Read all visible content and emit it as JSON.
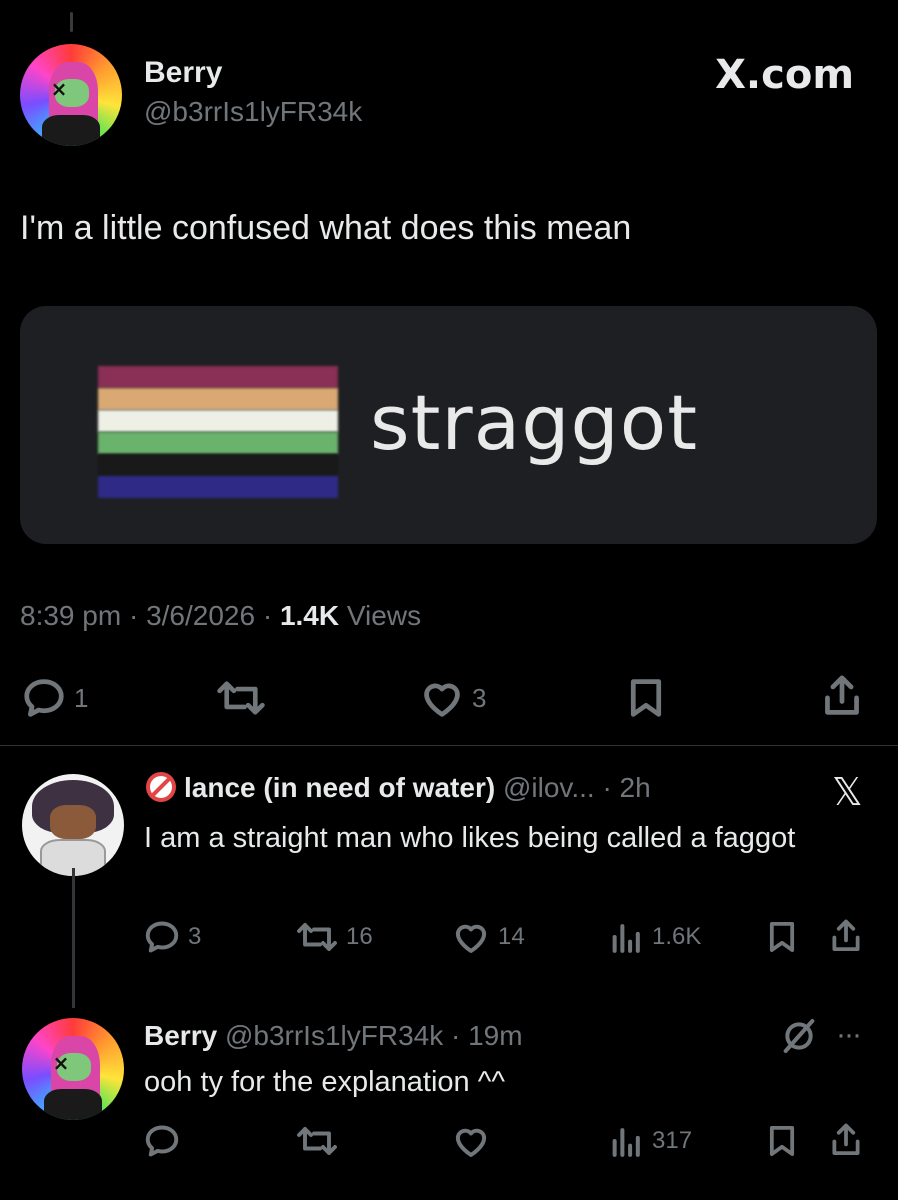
{
  "main_tweet": {
    "author_name": "Berry",
    "handle": "@b3rrIs1lyFR34k",
    "source_logo": "X.com",
    "text": "I'm a little confused what does this mean",
    "media": {
      "word": "straggot",
      "flag_colors": [
        "#8a2f55",
        "#d9a873",
        "#eef0e6",
        "#6ab36c",
        "#2e2a86"
      ]
    },
    "time": "8:39 pm",
    "date": "3/6/2026",
    "views_count": "1.4K",
    "views_label": "Views",
    "replies": "1",
    "likes": "3"
  },
  "reply1": {
    "author_name": "lance (in need of water)",
    "handle": "@ilov...",
    "age": "· 2h",
    "text": "I am a straight man who likes being called a faggot",
    "replies": "3",
    "reposts": "16",
    "likes": "14",
    "views": "1.6K"
  },
  "reply2": {
    "author_name": "Berry",
    "handle": "@b3rrIs1lyFR34k",
    "age": "· 19m",
    "text": "ooh ty for the explanation ^^",
    "views": "317"
  },
  "colors": {
    "background": "#000000",
    "text": "#e7e9ea",
    "muted": "#71767b",
    "card": "#1e1f22"
  }
}
